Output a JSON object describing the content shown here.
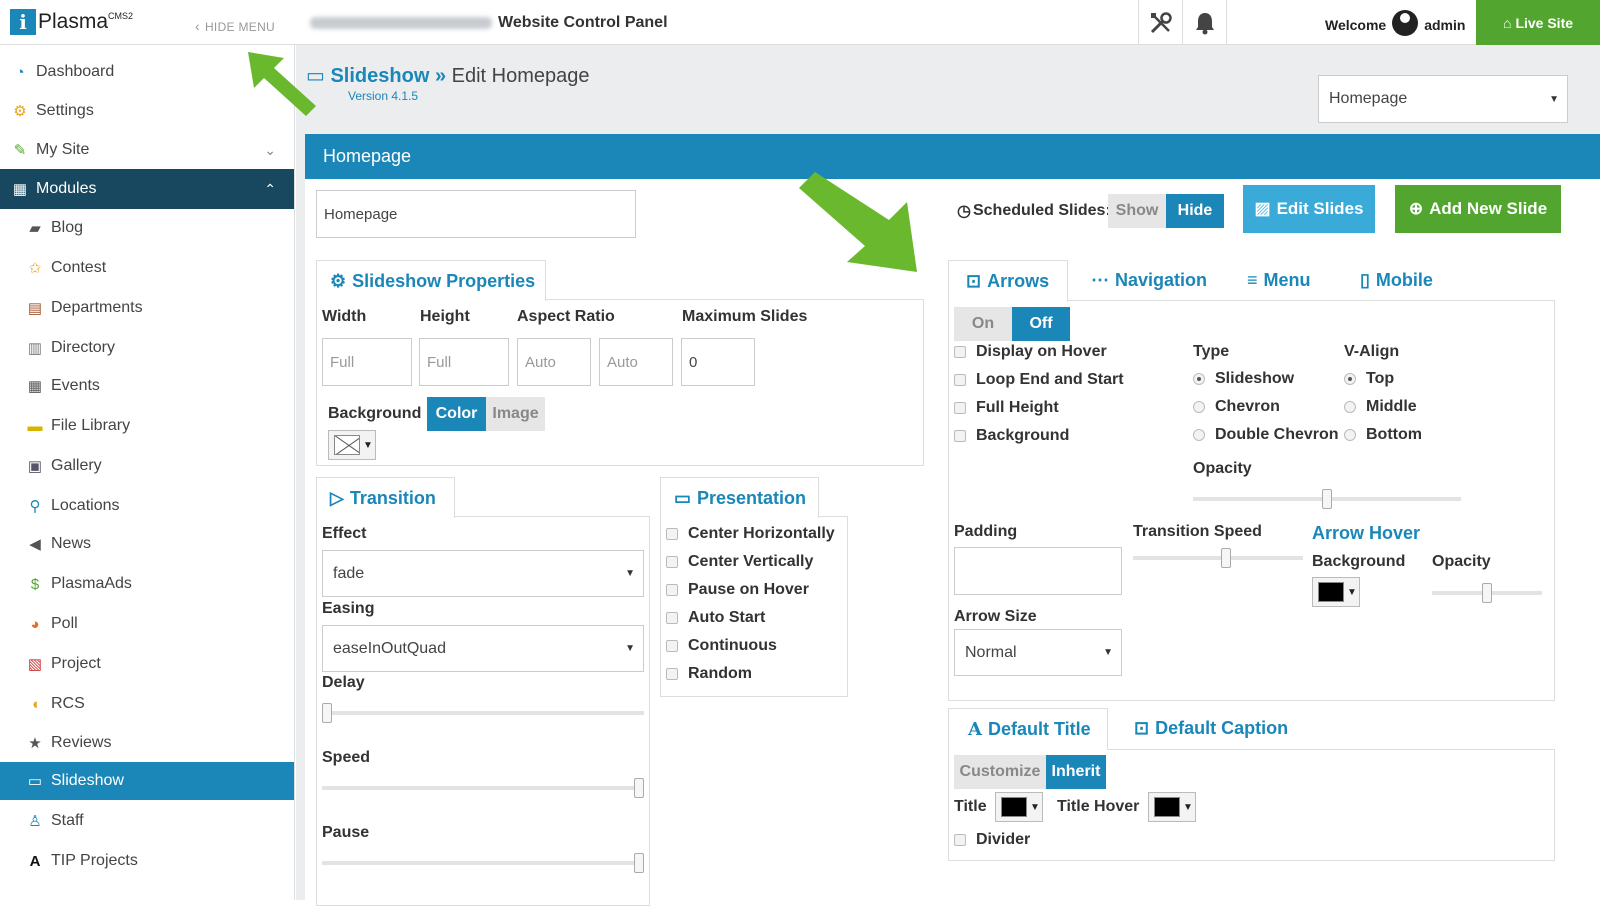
{
  "topbar": {
    "logo_letter": "i",
    "logo_name": "Plasma",
    "logo_sup": "CMS2",
    "hide_menu": "HIDE MENU",
    "site_title": "Website Control Panel",
    "tools_icon": "tools-icon",
    "bell_icon": "bell-icon",
    "welcome": "Welcome",
    "username": "admin",
    "live_site": "Live Site"
  },
  "sidebar": {
    "top_items": [
      {
        "label": "Dashboard",
        "icon": "dashboard-icon"
      },
      {
        "label": "Settings",
        "icon": "gears-icon"
      },
      {
        "label": "My Site",
        "icon": "edit-icon"
      }
    ],
    "modules_label": "Modules",
    "modules": [
      {
        "label": "Blog",
        "icon": "blog-icon"
      },
      {
        "label": "Contest",
        "icon": "star-icon"
      },
      {
        "label": "Departments",
        "icon": "departments-icon"
      },
      {
        "label": "Directory",
        "icon": "directory-icon"
      },
      {
        "label": "Events",
        "icon": "calendar-icon"
      },
      {
        "label": "File Library",
        "icon": "folder-icon"
      },
      {
        "label": "Gallery",
        "icon": "gallery-icon"
      },
      {
        "label": "Locations",
        "icon": "map-pin-icon"
      },
      {
        "label": "News",
        "icon": "megaphone-icon"
      },
      {
        "label": "PlasmaAds",
        "icon": "dollar-icon"
      },
      {
        "label": "Poll",
        "icon": "pie-chart-icon"
      },
      {
        "label": "Project",
        "icon": "project-icon"
      },
      {
        "label": "RCS",
        "icon": "rcs-icon"
      },
      {
        "label": "Reviews",
        "icon": "star-icon"
      },
      {
        "label": "Slideshow",
        "icon": "slideshow-icon"
      },
      {
        "label": "Staff",
        "icon": "staff-icon"
      },
      {
        "label": "TIP Projects",
        "icon": "tip-icon"
      }
    ],
    "active_item": "Slideshow"
  },
  "header": {
    "module": "Slideshow",
    "separator": "»",
    "action": "Edit Homepage",
    "version": "Version 4.1.5",
    "slideshow_select": "Homepage"
  },
  "panel_title": "Homepage",
  "name_input": "Homepage",
  "scheduled": {
    "label": "Scheduled Slides:",
    "show": "Show",
    "hide": "Hide",
    "edit_slides": "Edit Slides",
    "add_new_slide": "Add New Slide"
  },
  "properties": {
    "tab": "Slideshow Properties",
    "width_label": "Width",
    "height_label": "Height",
    "aspect_label": "Aspect Ratio",
    "max_label": "Maximum Slides",
    "width_ph": "Full",
    "height_ph": "Full",
    "aspect_ph1": "Auto",
    "aspect_ph2": "Auto",
    "max_value": "0",
    "background_label": "Background",
    "color": "Color",
    "image": "Image"
  },
  "transition": {
    "tab": "Transition",
    "effect_label": "Effect",
    "effect_value": "fade",
    "easing_label": "Easing",
    "easing_value": "easeInOutQuad",
    "delay_label": "Delay",
    "speed_label": "Speed",
    "pause_label": "Pause",
    "delay_level": 0.0,
    "speed_level": 1.0,
    "pause_level": 1.0
  },
  "presentation": {
    "tab": "Presentation",
    "options": [
      "Center Horizontally",
      "Center Vertically",
      "Pause on Hover",
      "Auto Start",
      "Continuous",
      "Random"
    ]
  },
  "arrows": {
    "tabs": [
      "Arrows",
      "Navigation",
      "Menu",
      "Mobile"
    ],
    "on": "On",
    "off": "Off",
    "checks": [
      "Display on Hover",
      "Loop End and Start",
      "Full Height",
      "Background"
    ],
    "type_label": "Type",
    "types": [
      "Slideshow",
      "Chevron",
      "Double Chevron"
    ],
    "valign_label": "V-Align",
    "valigns": [
      "Top",
      "Middle",
      "Bottom"
    ],
    "opacity_label": "Opacity",
    "opacity_level": 0.5,
    "padding_label": "Padding",
    "transition_speed_label": "Transition Speed",
    "transition_speed_level": 0.55,
    "arrow_hover": "Arrow Hover",
    "hover_background": "Background",
    "hover_opacity": "Opacity",
    "hover_opacity_level": 0.5,
    "arrow_size_label": "Arrow Size",
    "arrow_size_value": "Normal"
  },
  "title_section": {
    "tabs": [
      "Default Title",
      "Default Caption"
    ],
    "customize": "Customize",
    "inherit": "Inherit",
    "title_label": "Title",
    "title_hover_label": "Title Hover",
    "divider": "Divider"
  },
  "colors": {
    "accent": "#1a87b8",
    "sidebar_dark": "#18485f",
    "green": "#52a630",
    "edit_slides_bg": "#3aaad8",
    "arrow_green": "#6ab82e"
  }
}
